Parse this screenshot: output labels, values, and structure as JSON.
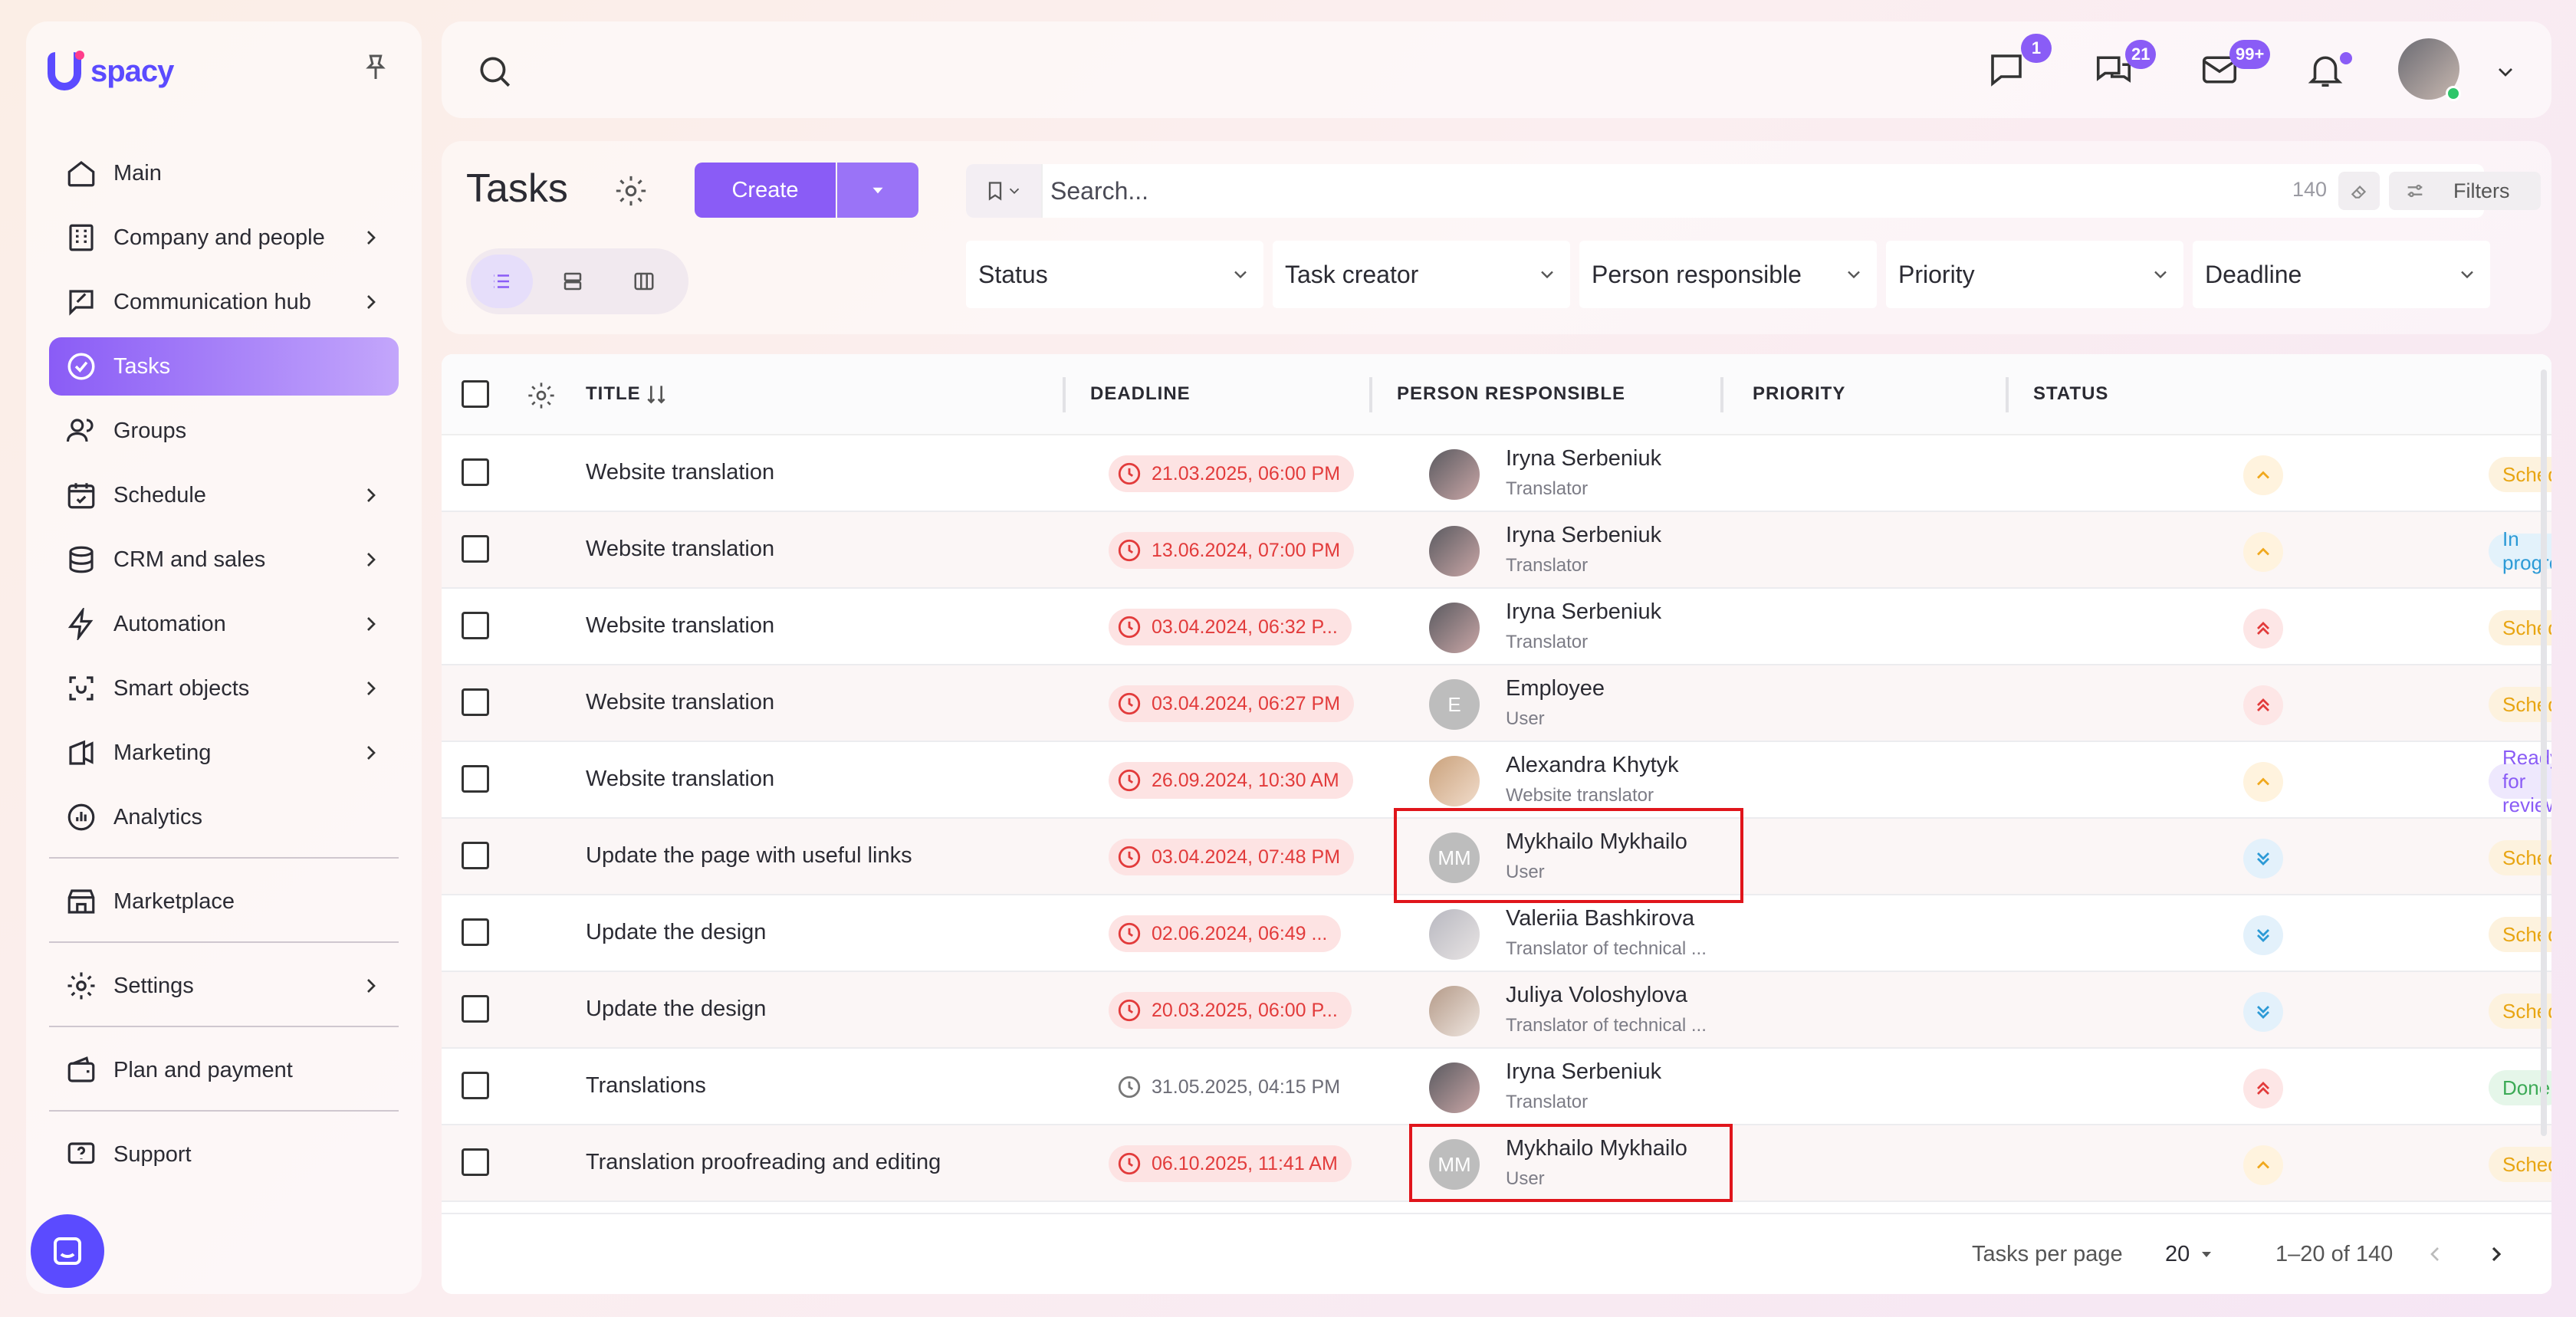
{
  "brand": {
    "logo_text": "spacy",
    "accent": "#8a5cf6"
  },
  "sidebar": {
    "items": [
      {
        "label": "Main",
        "icon": "home-icon",
        "has_arrow": false
      },
      {
        "label": "Company and people",
        "icon": "company-icon",
        "has_arrow": true
      },
      {
        "label": "Communication hub",
        "icon": "communication-icon",
        "has_arrow": true
      },
      {
        "label": "Tasks",
        "icon": "tasks-icon",
        "has_arrow": false,
        "active": true
      },
      {
        "label": "Groups",
        "icon": "groups-icon",
        "has_arrow": false
      },
      {
        "label": "Schedule",
        "icon": "calendar-icon",
        "has_arrow": true
      },
      {
        "label": "CRM and sales",
        "icon": "crm-icon",
        "has_arrow": true
      },
      {
        "label": "Automation",
        "icon": "lightning-icon",
        "has_arrow": true
      },
      {
        "label": "Smart objects",
        "icon": "smart-objects-icon",
        "has_arrow": true
      },
      {
        "label": "Marketing",
        "icon": "marketing-icon",
        "has_arrow": true
      },
      {
        "label": "Analytics",
        "icon": "analytics-icon",
        "has_arrow": false
      }
    ],
    "marketplace": "Marketplace",
    "settings": "Settings",
    "plan": "Plan and payment",
    "support": "Support"
  },
  "topbar": {
    "badges": {
      "messages": "1",
      "chats": "21",
      "mail": "99+"
    }
  },
  "tasks_header": {
    "title": "Tasks",
    "create_label": "Create",
    "search_placeholder": "Search...",
    "search_count": "140",
    "filters_label": "Filters",
    "filters": [
      "Status",
      "Task creator",
      "Person responsible",
      "Priority",
      "Deadline"
    ]
  },
  "table": {
    "columns": {
      "title": "TITLE",
      "deadline": "DEADLINE",
      "person": "PERSON RESPONSIBLE",
      "priority": "PRIORITY",
      "status": "STATUS"
    },
    "rows": [
      {
        "title": "Website translation",
        "deadline": "21.03.2025, 06:00 PM",
        "overdue": true,
        "person": "Iryna Serbeniuk",
        "role": "Translator",
        "avatar": "photo-1",
        "priority": "medium",
        "status": "Scheduled"
      },
      {
        "title": "Website translation",
        "deadline": "13.06.2024, 07:00 PM",
        "overdue": true,
        "person": "Iryna Serbeniuk",
        "role": "Translator",
        "avatar": "photo-1",
        "priority": "medium",
        "status": "In progress"
      },
      {
        "title": "Website translation",
        "deadline": "03.04.2024, 06:32 P...",
        "overdue": true,
        "person": "Iryna Serbeniuk",
        "role": "Translator",
        "avatar": "photo-1",
        "priority": "high",
        "status": "Scheduled"
      },
      {
        "title": "Website translation",
        "deadline": "03.04.2024, 06:27 PM",
        "overdue": true,
        "person": "Employee",
        "role": "User",
        "avatar": "E",
        "priority": "high",
        "status": "Scheduled"
      },
      {
        "title": "Website translation",
        "deadline": "26.09.2024, 10:30 AM",
        "overdue": true,
        "person": "Alexandra Khytyk",
        "role": "Website translator",
        "avatar": "photo-2",
        "priority": "medium",
        "status": "Ready for review"
      },
      {
        "title": "Update the page with useful links",
        "deadline": "03.04.2024, 07:48 PM",
        "overdue": true,
        "person": "Mykhailo Mykhailo",
        "role": "User",
        "avatar": "MM",
        "priority": "low",
        "status": "Scheduled"
      },
      {
        "title": "Update the design",
        "deadline": "02.06.2024, 06:49 ...",
        "overdue": true,
        "person": "Valeriia Bashkirova",
        "role": "Translator of technical ...",
        "avatar": "photo-3",
        "priority": "low",
        "status": "Scheduled"
      },
      {
        "title": "Update the design",
        "deadline": "20.03.2025, 06:00 P...",
        "overdue": true,
        "person": "Juliya Voloshylova",
        "role": "Translator of technical ...",
        "avatar": "photo-4",
        "priority": "low",
        "status": "Scheduled"
      },
      {
        "title": "Translations",
        "deadline": "31.05.2025, 04:15 PM",
        "overdue": false,
        "person": "Iryna Serbeniuk",
        "role": "Translator",
        "avatar": "photo-1",
        "priority": "high",
        "status": "Done"
      },
      {
        "title": "Translation proofreading and editing",
        "deadline": "06.10.2025, 11:41 AM",
        "overdue": true,
        "person": "Mykhailo Mykhailo",
        "role": "User",
        "avatar": "MM",
        "priority": "medium",
        "status": "Scheduled"
      }
    ]
  },
  "footer": {
    "per_page_label": "Tasks per page",
    "per_page": "20",
    "range": "1–20 of 140"
  }
}
